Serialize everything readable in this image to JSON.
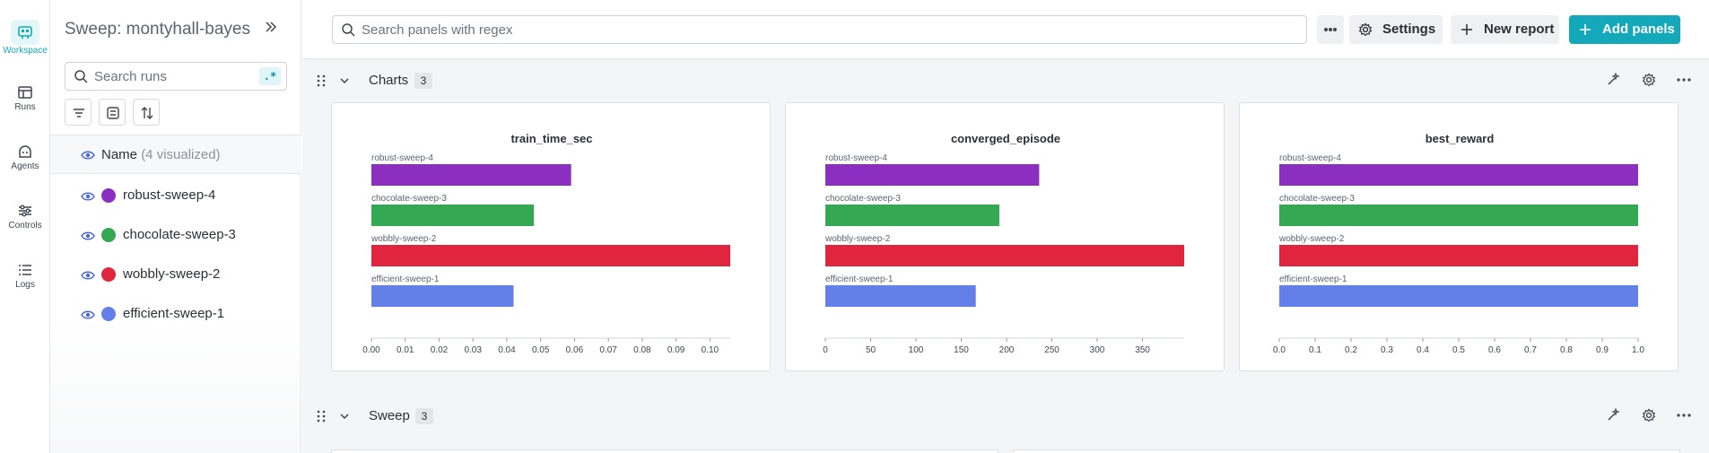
{
  "rail": {
    "items": [
      {
        "label": "Workspace",
        "icon": "workspace-icon",
        "active": true
      },
      {
        "label": "Runs",
        "icon": "table-icon",
        "active": false
      },
      {
        "label": "Agents",
        "icon": "agent-icon",
        "active": false
      },
      {
        "label": "Controls",
        "icon": "sliders-icon",
        "active": false
      },
      {
        "label": "Logs",
        "icon": "list-icon",
        "active": false
      }
    ]
  },
  "sidebar": {
    "title": "Sweep: montyhall-bayes",
    "search_placeholder": "Search runs",
    "regex_badge": ".*",
    "header": {
      "name": "Name",
      "count": "(4 visualized)"
    },
    "runs": [
      {
        "name": "robust-sweep-4",
        "color": "#8a2fbf"
      },
      {
        "name": "chocolate-sweep-3",
        "color": "#34a853"
      },
      {
        "name": "wobbly-sweep-2",
        "color": "#e0263f"
      },
      {
        "name": "efficient-sweep-1",
        "color": "#6480e8"
      }
    ]
  },
  "topbar": {
    "search_placeholder": "Search panels with regex",
    "settings_label": "Settings",
    "new_report_label": "New report",
    "add_panels_label": "Add panels"
  },
  "sections": [
    {
      "title": "Charts",
      "count": "3"
    },
    {
      "title": "Sweep",
      "count": "3"
    }
  ],
  "colors": {
    "accent": "#13a9ba"
  },
  "chart_data": [
    {
      "type": "bar",
      "orientation": "horizontal",
      "title": "train_time_sec",
      "categories": [
        "robust-sweep-4",
        "chocolate-sweep-3",
        "wobbly-sweep-2",
        "efficient-sweep-1"
      ],
      "values": [
        0.059,
        0.048,
        0.106,
        0.042
      ],
      "colors": [
        "#8a2fbf",
        "#34a853",
        "#e0263f",
        "#6480e8"
      ],
      "xlim": [
        0,
        0.106
      ],
      "ticks": [
        0,
        0.01,
        0.02,
        0.03,
        0.04,
        0.05,
        0.06,
        0.07,
        0.08,
        0.09,
        0.1
      ],
      "tick_labels": [
        "0.00",
        "0.01",
        "0.02",
        "0.03",
        "0.04",
        "0.05",
        "0.06",
        "0.07",
        "0.08",
        "0.09",
        "0.10"
      ]
    },
    {
      "type": "bar",
      "orientation": "horizontal",
      "title": "converged_episode",
      "categories": [
        "robust-sweep-4",
        "chocolate-sweep-3",
        "wobbly-sweep-2",
        "efficient-sweep-1"
      ],
      "values": [
        236,
        192,
        396,
        166
      ],
      "colors": [
        "#8a2fbf",
        "#34a853",
        "#e0263f",
        "#6480e8"
      ],
      "xlim": [
        0,
        396
      ],
      "ticks": [
        0,
        50,
        100,
        150,
        200,
        250,
        300,
        350
      ],
      "tick_labels": [
        "0",
        "50",
        "100",
        "150",
        "200",
        "250",
        "300",
        "350"
      ]
    },
    {
      "type": "bar",
      "orientation": "horizontal",
      "title": "best_reward",
      "categories": [
        "robust-sweep-4",
        "chocolate-sweep-3",
        "wobbly-sweep-2",
        "efficient-sweep-1"
      ],
      "values": [
        1.0,
        1.0,
        1.0,
        1.0
      ],
      "colors": [
        "#8a2fbf",
        "#34a853",
        "#e0263f",
        "#6480e8"
      ],
      "xlim": [
        0,
        1.0
      ],
      "ticks": [
        0,
        0.1,
        0.2,
        0.3,
        0.4,
        0.5,
        0.6,
        0.7,
        0.8,
        0.9,
        1.0
      ],
      "tick_labels": [
        "0.0",
        "0.1",
        "0.2",
        "0.3",
        "0.4",
        "0.5",
        "0.6",
        "0.7",
        "0.8",
        "0.9",
        "1.0"
      ]
    }
  ]
}
